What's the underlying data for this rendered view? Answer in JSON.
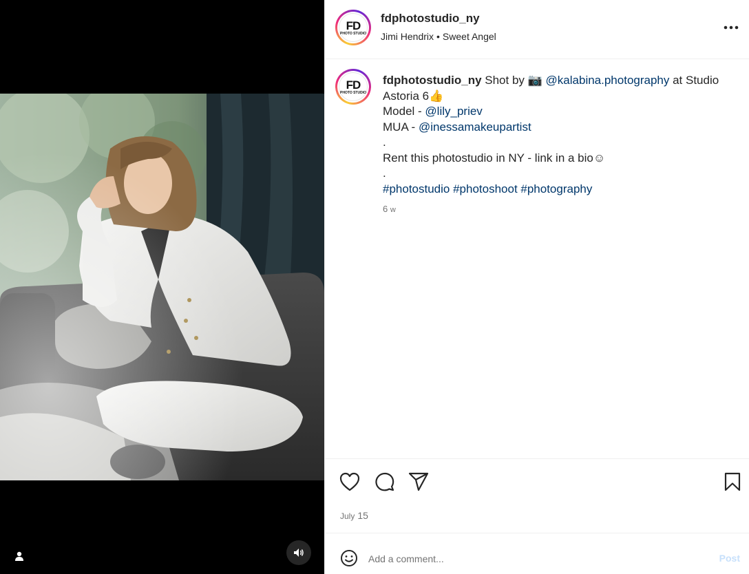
{
  "media": {
    "user_icon": "user-icon",
    "sound_icon": "speaker-icon"
  },
  "header": {
    "username": "fdphotostudio_ny",
    "avatar_text": "FD",
    "avatar_sub": "PHOTO STUDIO",
    "audio_artist": "Jimi Hendrix",
    "audio_separator": "•",
    "audio_track": "Sweet Angel",
    "more_icon": "ellipsis-icon"
  },
  "caption": {
    "username": "fdphotostudio_ny",
    "text_1": " Shot by ",
    "camera_emoji": "📷",
    "mention_1": "@kalabina.photography",
    "text_2": " at Studio Astoria 6",
    "thumbs_emoji": "👍",
    "model_label": "Model - ",
    "mention_2": "@lily_priev",
    "mua_label": "MUA - ",
    "mention_3": "@inessamakeupartist",
    "dot_1": ".",
    "rent_line": "Rent this photostudio in NY - link in a bio",
    "smile_emoji": "☺",
    "dot_2": ".",
    "hashtags": "#photostudio #photoshoot #photography",
    "time_num": "6",
    "time_unit": "w"
  },
  "actions": {
    "like_icon": "heart-icon",
    "comment_icon": "comment-icon",
    "share_icon": "share-icon",
    "save_icon": "bookmark-icon",
    "date_month": "July",
    "date_day": "15"
  },
  "comment": {
    "emoji_icon": "smiley-icon",
    "placeholder": "Add a comment...",
    "post_label": "Post"
  },
  "colors": {
    "link": "#00376b",
    "muted": "#737373",
    "post_disabled": "#c7e0fb",
    "text": "#262626"
  }
}
